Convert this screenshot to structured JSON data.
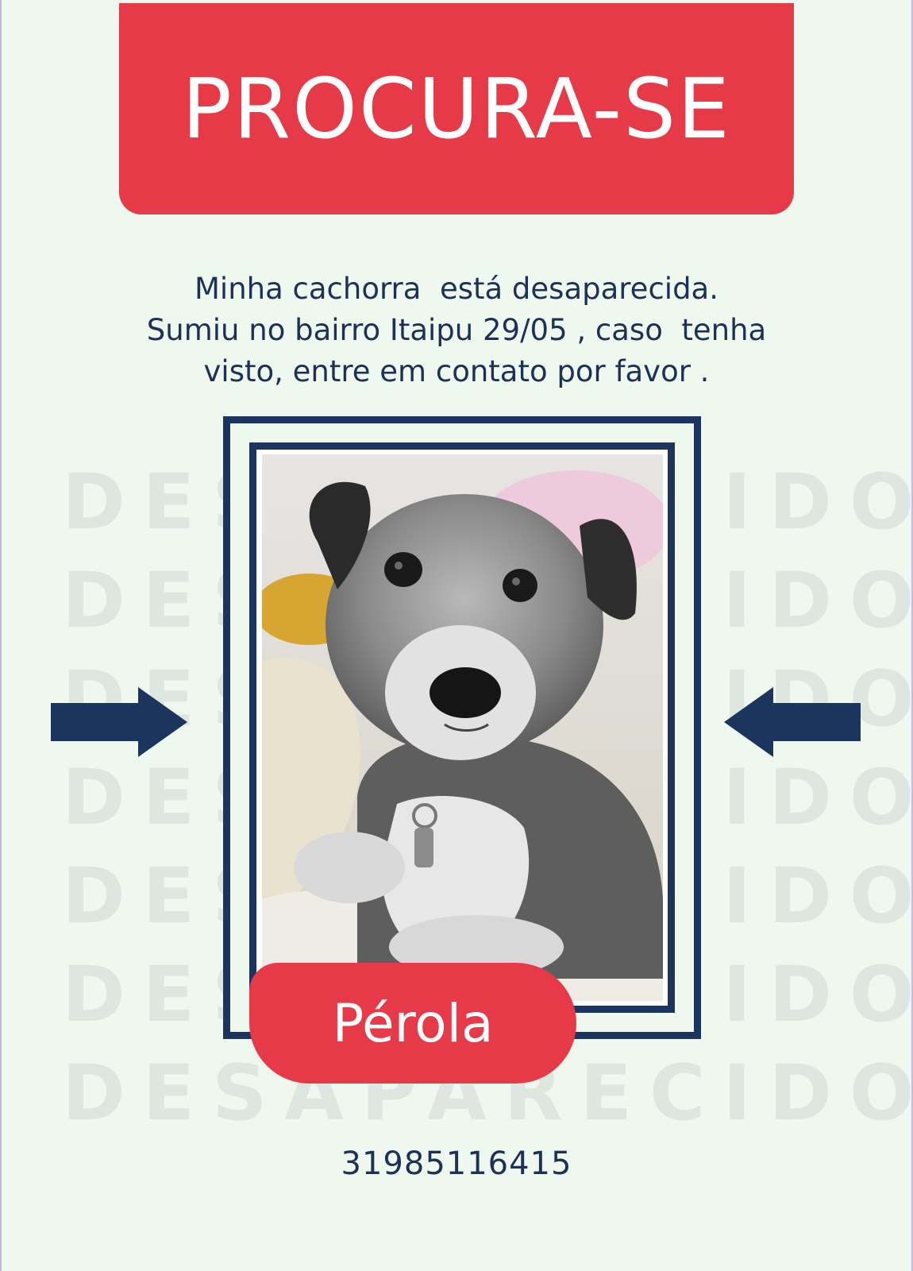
{
  "header": {
    "title": "PROCURA-SE"
  },
  "message": {
    "lines": [
      "Minha cachorra  está desaparecida.",
      "Sumiu no bairro Itaipu 29/05 , caso  tenha",
      "visto, entre em contato por favor ."
    ]
  },
  "watermark": {
    "lines": [
      "DESAPARECIDO",
      "DESAPARECIDO",
      "DESAPARECIDO",
      "DESAPARECIDO",
      "DESAPARECIDO",
      "DESAPARECIDO",
      "DESAPARECIDO"
    ]
  },
  "pet": {
    "name": "Pérola",
    "photo_icon": "dog-photo"
  },
  "contact": {
    "phone": "31985116415"
  },
  "colors": {
    "accent": "#e63a49",
    "navy": "#1b355f",
    "background": "#eff8ef",
    "watermark": "#dde6df"
  }
}
